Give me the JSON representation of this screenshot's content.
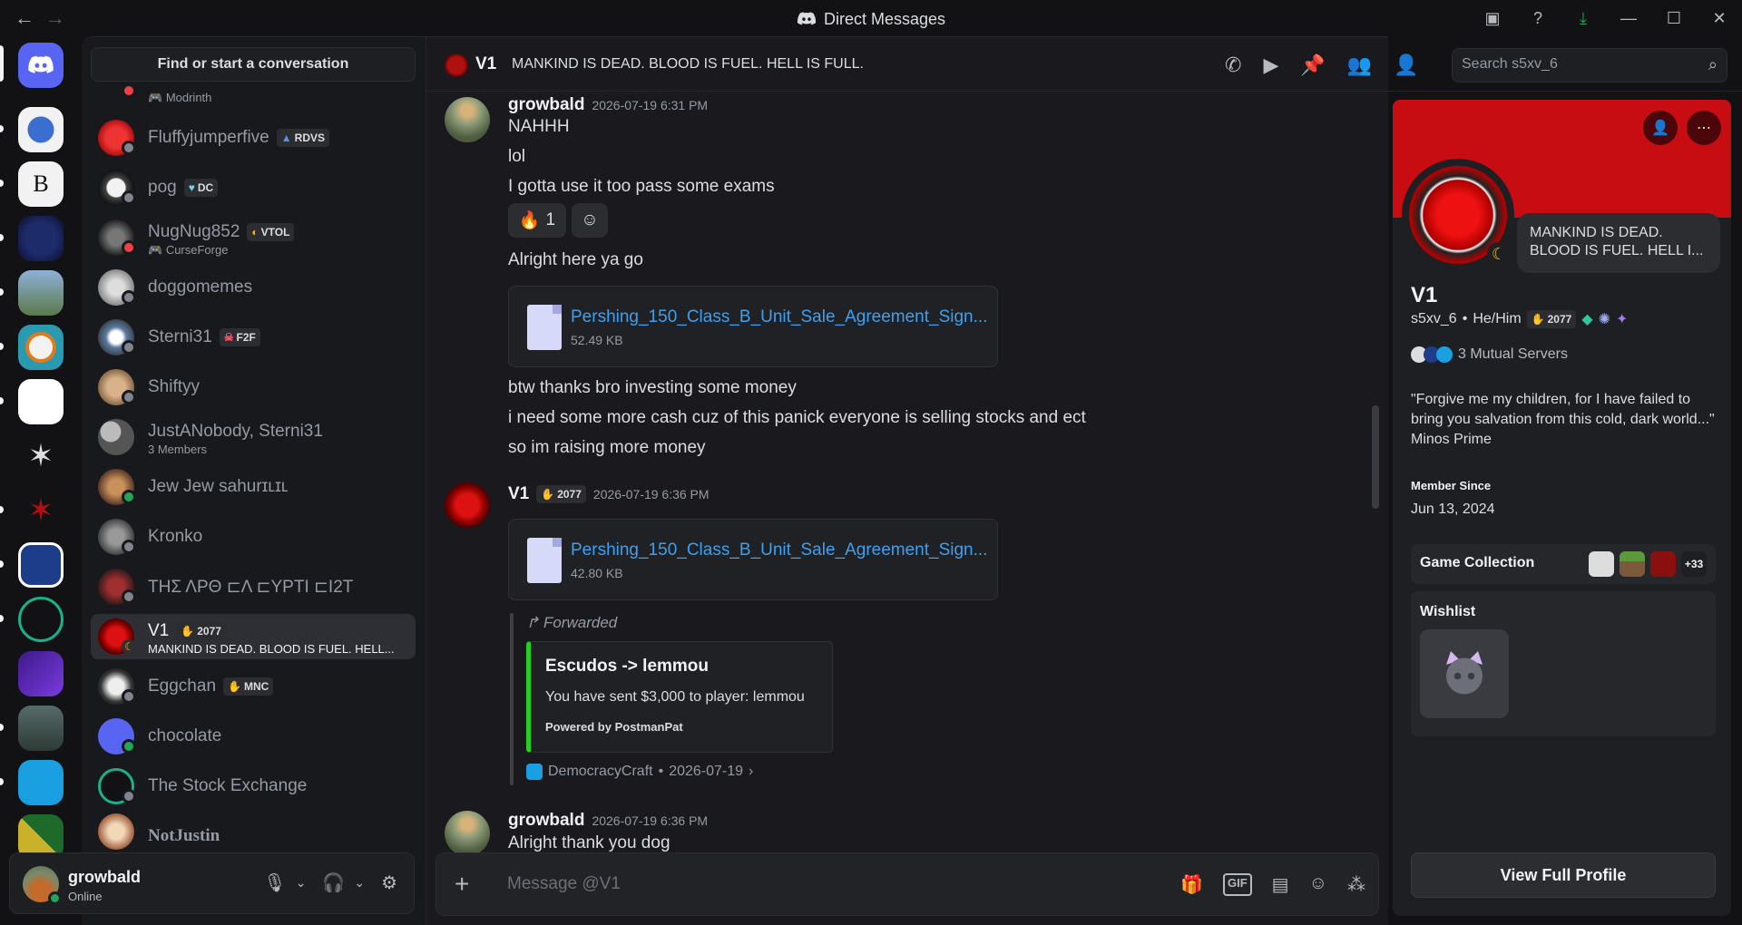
{
  "window": {
    "title": "Direct Messages",
    "back": "←",
    "forward": "→"
  },
  "dm_list": {
    "search_label": "Find or start a conversation",
    "items": [
      {
        "name": "",
        "sub": "Modrinth",
        "status": "dnd"
      },
      {
        "name": "Fluffyjumperfive",
        "tag": "RDVS",
        "status": "offline"
      },
      {
        "name": "pog",
        "tag": "DC",
        "status": "offline"
      },
      {
        "name": "NugNug852",
        "tag": "VTOL",
        "sub": "CurseForge",
        "status": "dnd"
      },
      {
        "name": "doggomemes",
        "status": "offline"
      },
      {
        "name": "Sterni31",
        "tag": "F2F",
        "status": "offline"
      },
      {
        "name": "Shiftyy",
        "status": "offline"
      },
      {
        "name": "JustANobody, Sterni31",
        "sub": "3 Members"
      },
      {
        "name": "Jew Jew sahurɪʟɪʟ",
        "status": "online"
      },
      {
        "name": "Kronko",
        "status": "offline"
      },
      {
        "name": "ΤΗΣ ΛΡΘ ⊏Λ ⊏ΥΡΤΙ ⊏Ι2Τ",
        "status": "offline"
      },
      {
        "name": "V1",
        "tag": "2077",
        "sub": "MANKIND IS DEAD. BLOOD IS FUEL. HELL...",
        "status": "idle"
      },
      {
        "name": "Eggchan",
        "tag": "MNC",
        "status": "offline"
      },
      {
        "name": "chocolate",
        "status": "online"
      },
      {
        "name": "The Stock Exchange",
        "status": "offline"
      },
      {
        "name": "NotJustin",
        "status": "offline"
      }
    ]
  },
  "user_panel": {
    "name": "growbald",
    "status": "Online"
  },
  "chat": {
    "header_name": "V1",
    "header_topic": "MANKIND IS DEAD. BLOOD IS FUEL. HELL IS FULL.",
    "search_placeholder": "Search s5xv_6",
    "composer_placeholder": "Message @V1",
    "messages": {
      "m1": {
        "author": "growbald",
        "time": "2026-07-19 6:31 PM",
        "lines": [
          "NAHHH",
          "lol",
          "I gotta use it too pass some exams"
        ],
        "reaction_emoji": "🔥",
        "reaction_count": "1"
      },
      "m1b": {
        "text": "Alright here ya go",
        "file_name": "Pershing_150_Class_B_Unit_Sale_Agreement_Sign...",
        "file_size": "52.49 KB"
      },
      "m1c": {
        "lines": [
          "btw thanks bro investing some money",
          "i need some more cash cuz of this panick everyone is selling stocks and ect",
          "so im raising more money"
        ]
      },
      "m2": {
        "author": "V1",
        "tag": "2077",
        "time": "2026-07-19 6:36 PM",
        "file_name": "Pershing_150_Class_B_Unit_Sale_Agreement_Sign...",
        "file_size": "42.80 KB",
        "forward_label": "Forwarded",
        "embed_title": "Escudos -> lemmou",
        "embed_desc": "You have sent $3,000 to player: lemmou",
        "embed_footer": "Powered by PostmanPat",
        "forward_source": "DemocracyCraft",
        "forward_date": "2026-07-19"
      },
      "m3": {
        "author": "growbald",
        "time": "2026-07-19 6:36 PM",
        "text": "Alright thank you dog"
      }
    }
  },
  "profile": {
    "custom_status": "MANKIND IS DEAD. BLOOD IS FUEL. HELL I...",
    "display_name": "V1",
    "username": "s5xv_6",
    "pronouns": "He/Him",
    "tag": "2077",
    "mutual_servers": "3 Mutual Servers",
    "bio": "\"Forgive me my children, for I have failed to bring you salvation from this cold, dark world...\" Minos Prime",
    "member_since_label": "Member Since",
    "member_since": "Jun 13, 2024",
    "game_collection_label": "Game Collection",
    "game_more": "+33",
    "wishlist_label": "Wishlist",
    "view_full_profile": "View Full Profile"
  },
  "colors": {
    "accent": "#5865f2",
    "online": "#23a55a",
    "dnd": "#f23f43",
    "idle": "#f0b232",
    "banner": "#c70c12"
  }
}
